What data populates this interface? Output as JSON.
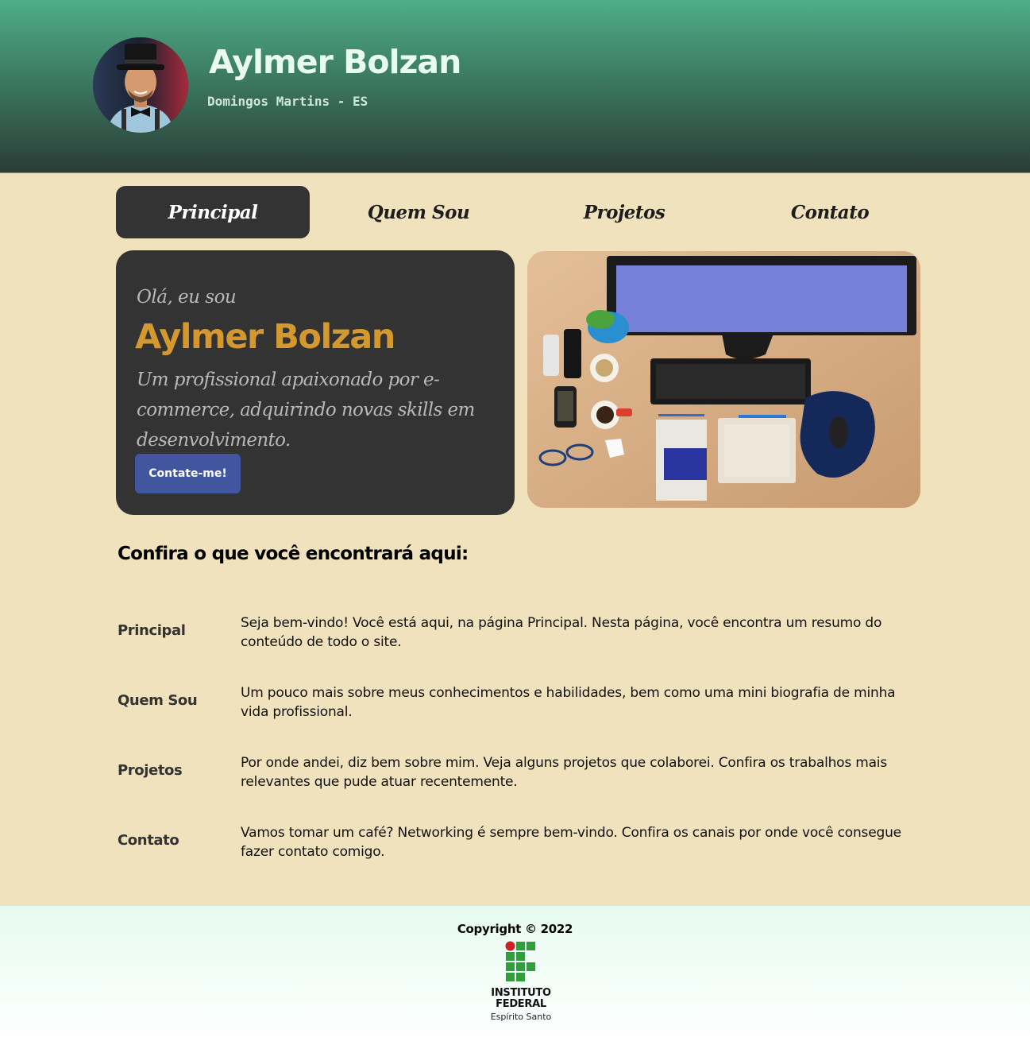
{
  "header": {
    "name": "Aylmer Bolzan",
    "location": "Domingos Martins - ES"
  },
  "nav": {
    "tabs": [
      {
        "label": "Principal",
        "active": true
      },
      {
        "label": "Quem Sou",
        "active": false
      },
      {
        "label": "Projetos",
        "active": false
      },
      {
        "label": "Contato",
        "active": false
      }
    ]
  },
  "hero": {
    "greeting": "Olá, eu sou",
    "name": "Aylmer Bolzan",
    "tagline": "Um profissional apaixonado por e-commerce, adquirindo novas skills em desenvolvimento.",
    "button_label": "Contate-me!"
  },
  "section": {
    "title": "Confira o que você encontrará aqui:",
    "rows": [
      {
        "label": "Principal",
        "text": "Seja bem-vindo! Você está aqui, na página Principal. Nesta página, você encontra um resumo do conteúdo de todo o site."
      },
      {
        "label": "Quem Sou",
        "text": "Um pouco mais sobre meus conhecimentos e habilidades, bem como uma mini biografia de minha vida profissional."
      },
      {
        "label": "Projetos",
        "text": "Por onde andei, diz bem sobre mim. Veja alguns projetos que colaborei. Confira os trabalhos mais relevantes que pude atuar recentemente."
      },
      {
        "label": "Contato",
        "text": "Vamos tomar um café? Networking é sempre bem-vindo. Confira os canais por onde você consegue fazer contato comigo."
      }
    ]
  },
  "footer": {
    "copyright": "Copyright © 2022",
    "logo_line1": "INSTITUTO",
    "logo_line2": "FEDERAL",
    "logo_line3": "Espírito Santo"
  },
  "colors": {
    "page_bg": "#f0e2bc",
    "header_top": "#4fae88",
    "header_bottom": "#2a3d36",
    "card_bg": "#333333",
    "accent_name": "#d4982f",
    "button": "#42559f",
    "logo_green": "#2f9e3d",
    "logo_red": "#d21f26"
  }
}
